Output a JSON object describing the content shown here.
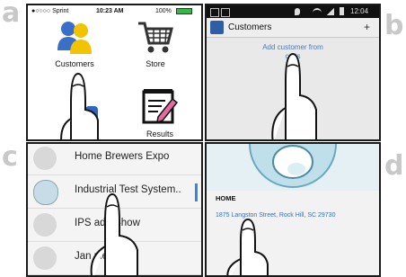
{
  "panel_letters": [
    "a",
    "b",
    "c",
    "d"
  ],
  "panel_a": {
    "carrier": "●○○○○ Sprint",
    "time": "10:23 AM",
    "battery": "100%",
    "tiles": [
      {
        "label": "Customers",
        "icon": "customers-icon"
      },
      {
        "label": "Store",
        "icon": "cart-icon"
      },
      {
        "label": "Results",
        "icon": "results-icon"
      }
    ]
  },
  "panel_b": {
    "time": "12:04",
    "title": "Customers",
    "add_button": "+",
    "add_link_line1": "Add customer from",
    "add_link_line2": "co       ts"
  },
  "panel_c": {
    "items": [
      "Home Brewers Expo",
      "Industrial Test System..",
      "IPS        ade Show",
      "Jan          pley"
    ]
  },
  "panel_d": {
    "section_label": "HOME",
    "address": "1875 Langston Street, Rock Hill, SC 29730"
  },
  "colors": {
    "accent_blue": "#3b6fb5",
    "link_blue": "#4a7ab8",
    "frame": "#1a1a1a"
  }
}
